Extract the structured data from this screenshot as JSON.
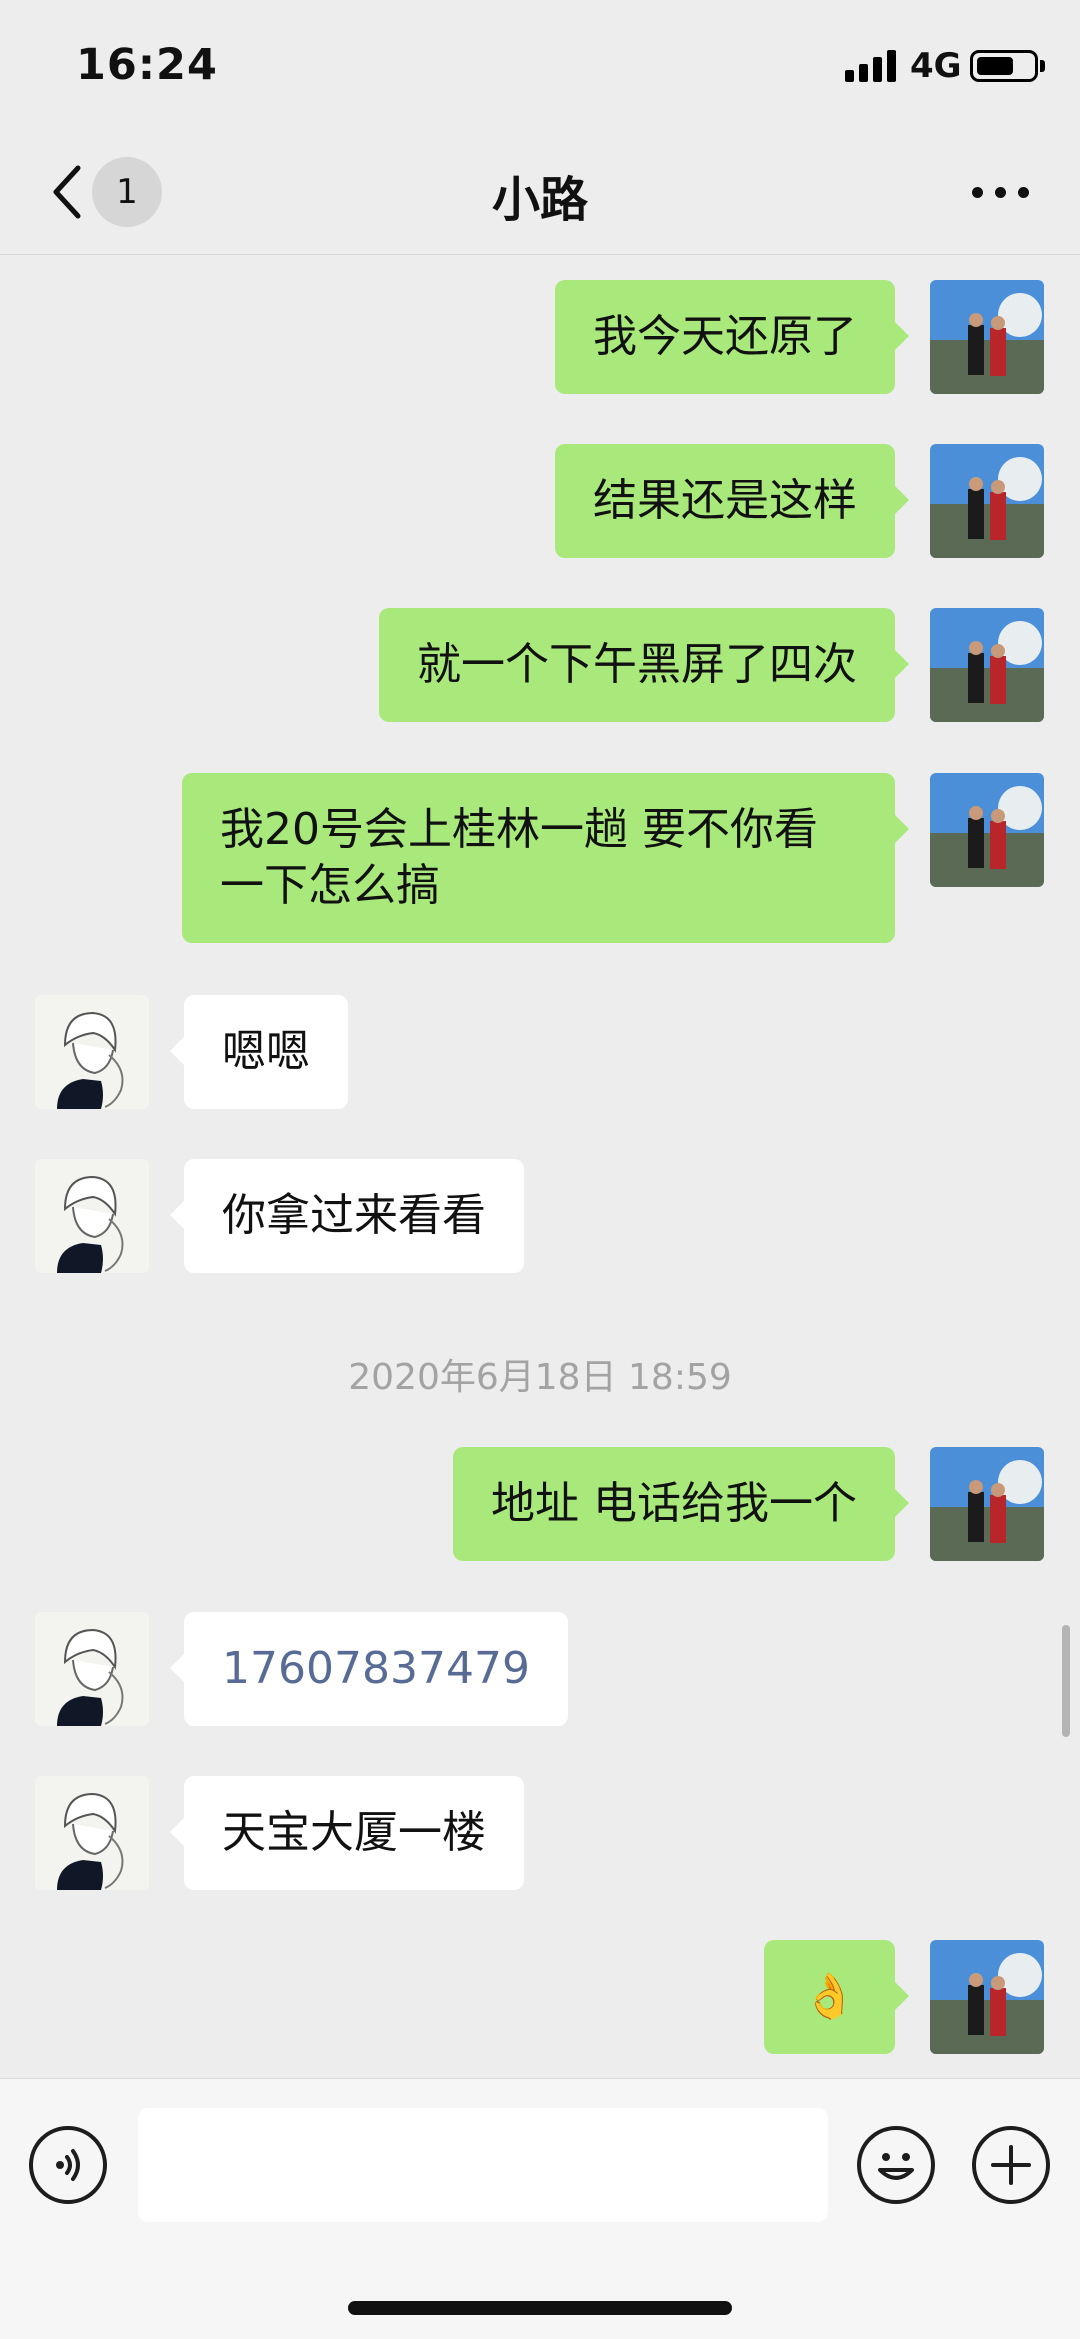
{
  "status_bar": {
    "time": "16:24",
    "network": "4G",
    "battery_level": 0.65
  },
  "header": {
    "back_badge": "1",
    "title": "小路"
  },
  "messages": [
    {
      "side": "out",
      "text": "我今天还原了"
    },
    {
      "side": "out",
      "text": "结果还是这样"
    },
    {
      "side": "out",
      "text": "就一个下午黑屏了四次"
    },
    {
      "side": "out",
      "line1": "我20号会上桂林一趟 要不你看",
      "line2": "一下怎么搞"
    },
    {
      "side": "in",
      "text": "嗯嗯"
    },
    {
      "side": "in",
      "text": "你拿过来看看"
    },
    {
      "side": "out",
      "text": "地址 电话给我一个"
    },
    {
      "side": "in",
      "text": "17607837479"
    },
    {
      "side": "in",
      "text": "天宝大厦一楼"
    },
    {
      "side": "out",
      "text": "👌"
    }
  ],
  "timestamp": "2020年6月18日 18:59",
  "input": {
    "placeholder": ""
  },
  "icons": {
    "back": "chevron-left-icon",
    "more": "more-dots-icon",
    "voice": "voice-icon",
    "emoji": "emoji-icon",
    "plus": "plus-icon"
  },
  "colors": {
    "outgoing_bubble": "#a9e87b",
    "incoming_bubble": "#ffffff",
    "phone_link": "#576b95",
    "background": "#ededed"
  }
}
